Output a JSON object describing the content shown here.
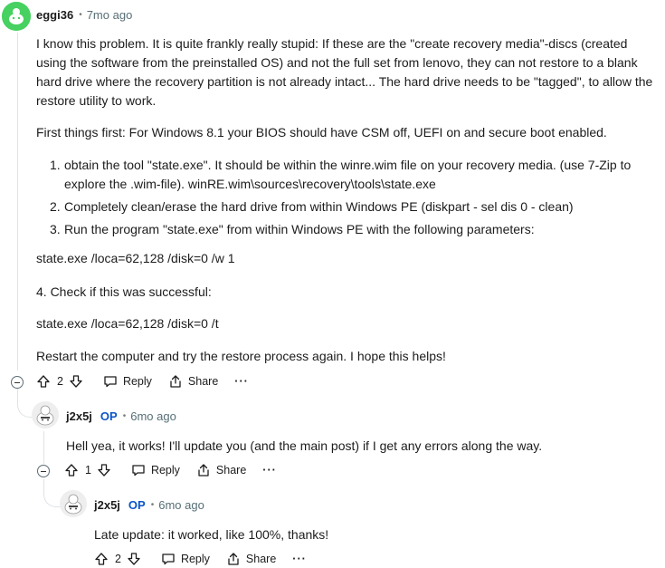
{
  "comments": [
    {
      "author": "eggi36",
      "time": "7mo ago",
      "body": {
        "p1": "I know this problem. It is quite frankly really stupid: If these are the \"create recovery media\"-discs (created using the software from the preinstalled OS) and not the full set from lenovo, they can not restore to a blank hard drive where the recovery partition is not already intact... The hard drive needs to be \"tagged\", to allow the restore utility to work.",
        "p2": "First things first: For Windows 8.1 your BIOS should have CSM off, UEFI on and secure boot enabled.",
        "list": [
          {
            "num": "1.",
            "text": "obtain the tool \"state.exe\". It should be within the winre.wim file on your recovery media. (use 7-Zip to explore the .wim-file). winRE.wim\\sources\\recovery\\tools\\state.exe"
          },
          {
            "num": "2.",
            "text": "Completely clean/erase the hard drive from within Windows PE (diskpart - sel dis 0 - clean)"
          },
          {
            "num": "3.",
            "text": "Run the program \"state.exe\" from within Windows PE with the following parameters:"
          }
        ],
        "p3": "state.exe /loca=62,128 /disk=0 /w 1",
        "p4": "4. Check if this was successful:",
        "p5": "state.exe /loca=62,128 /disk=0 /t",
        "p6": "Restart the computer and try the restore process again. I hope this helps!"
      },
      "votes": "2",
      "reply_label": "Reply",
      "share_label": "Share",
      "more_label": "···"
    },
    {
      "author": "j2x5j",
      "op_label": "OP",
      "time": "6mo ago",
      "body": "Hell yea, it works! I'll update you (and the main post) if I get any errors along the way.",
      "votes": "1",
      "reply_label": "Reply",
      "share_label": "Share",
      "more_label": "···"
    },
    {
      "author": "j2x5j",
      "op_label": "OP",
      "time": "6mo ago",
      "body": "Late update: it worked, like 100%, thanks!",
      "votes": "2",
      "reply_label": "Reply",
      "share_label": "Share",
      "more_label": "···"
    }
  ],
  "colors": {
    "avatar_green": "#46d160",
    "op_blue": "#0a55c8",
    "thread_line": "#dfe3e6"
  },
  "icons": [
    "upvote-icon",
    "downvote-icon",
    "reply-icon",
    "share-icon",
    "collapse-icon",
    "more-icon"
  ]
}
